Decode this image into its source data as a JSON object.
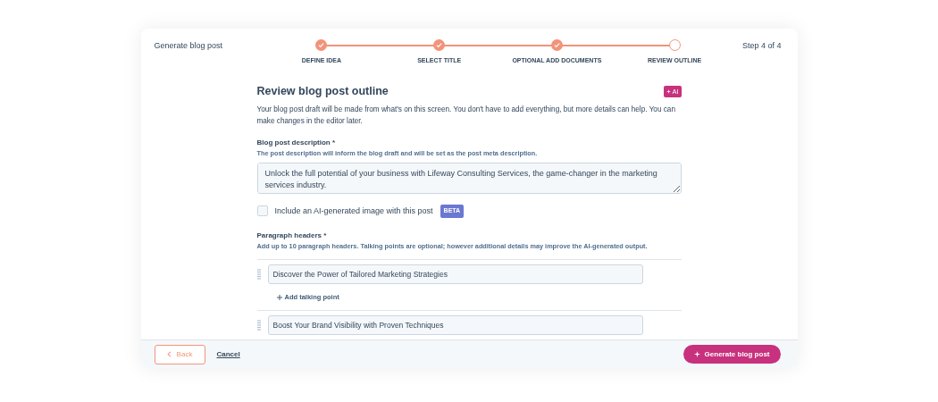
{
  "header": {
    "title": "Generate blog post",
    "step_counter": "Step 4 of 4"
  },
  "steps": [
    {
      "label": "DEFINE IDEA",
      "completed": true
    },
    {
      "label": "SELECT TITLE",
      "completed": true
    },
    {
      "label": "OPTIONAL ADD DOCUMENTS",
      "completed": true
    },
    {
      "label": "REVIEW OUTLINE",
      "completed": false
    }
  ],
  "outline": {
    "title": "Review blog post outline",
    "ai_badge": "AI",
    "intro": "Your blog post draft will be made from what's on this screen. You don't have to add everything, but more details can help. You can make changes in the editor later.",
    "description": {
      "label": "Blog post description *",
      "help": "The post description will inform the blog draft and will be set as the post meta description.",
      "value": "Unlock the full potential of your business with Lifeway Consulting Services, the game-changer in the marketing services industry."
    },
    "image_option": {
      "label": "Include an AI-generated image with this post",
      "badge": "BETA",
      "checked": false
    },
    "headers": {
      "label": "Paragraph headers *",
      "help": "Add up to 10 paragraph headers. Talking points are optional; however additional details may improve the AI-generated output.",
      "items": [
        {
          "value": "Discover the Power of Tailored Marketing Strategies",
          "add_label": "Add talking point"
        },
        {
          "value": "Boost Your Brand Visibility with Proven Techniques"
        }
      ]
    }
  },
  "footer": {
    "back": "Back",
    "cancel": "Cancel",
    "generate": "Generate blog post"
  }
}
